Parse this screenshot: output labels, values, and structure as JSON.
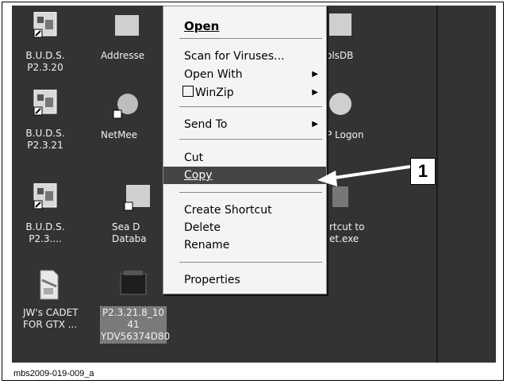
{
  "desktop_icons": [
    {
      "name": "buds-p2320",
      "lines": [
        "B.U.D.S.",
        "P2.3.20"
      ],
      "type": "app"
    },
    {
      "name": "buds-p2321",
      "lines": [
        "B.U.D.S.",
        "P2.3.21"
      ],
      "type": "app"
    },
    {
      "name": "buds-p23",
      "lines": [
        "B.U.D.S.",
        "P2.3...."
      ],
      "type": "app"
    },
    {
      "name": "jws-cadet",
      "lines": [
        "JW's CADET",
        "FOR GTX ..."
      ],
      "type": "doc"
    },
    {
      "name": "addresses",
      "lines": [
        "Addresse"
      ],
      "type": "partial"
    },
    {
      "name": "netmeeting",
      "lines": [
        "NetMee"
      ],
      "type": "partial"
    },
    {
      "name": "sea-doo-db",
      "lines": [
        "Sea D",
        "Databa"
      ],
      "type": "partial"
    },
    {
      "name": "p2321-folder",
      "lines": [
        "P2.3.21.8_10",
        "41",
        "YDV56374D80"
      ],
      "type": "folder",
      "selected": true
    },
    {
      "name": "toolsdb",
      "lines": [
        "olsDB"
      ],
      "type": "partial"
    },
    {
      "name": "logon",
      "lines": [
        "P Logon"
      ],
      "type": "partial"
    },
    {
      "name": "shortcut-to",
      "lines": [
        "rtcut to",
        "et.exe"
      ],
      "type": "partial"
    }
  ],
  "context_menu": {
    "open": "Open",
    "scan": "Scan for Viruses...",
    "open_with": "Open With",
    "winzip": "WinZip",
    "send_to": "Send To",
    "cut": "Cut",
    "copy": "Copy",
    "create_shortcut": "Create Shortcut",
    "delete": "Delete",
    "rename": "Rename",
    "properties": "Properties"
  },
  "callout_number": "1",
  "caption": "mbs2009-019-009_a"
}
